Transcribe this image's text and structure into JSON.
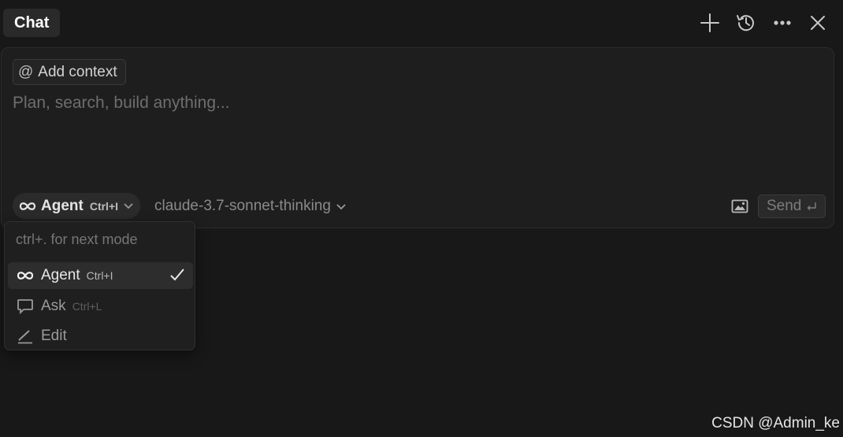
{
  "header": {
    "tab_label": "Chat",
    "icons": [
      "plus-icon",
      "history-icon",
      "more-icon",
      "close-icon"
    ]
  },
  "composer": {
    "add_context_label": "Add context",
    "add_context_symbol": "@",
    "placeholder": "Plan, search, build anything...",
    "value": "",
    "mode": {
      "label": "Agent",
      "shortcut": "Ctrl+I",
      "icon": "infinity-icon"
    },
    "model": "claude-3.7-sonnet-thinking",
    "send_label": "Send"
  },
  "mode_menu": {
    "hint": "ctrl+. for next mode",
    "items": [
      {
        "label": "Agent",
        "shortcut": "Ctrl+I",
        "icon": "infinity-icon",
        "selected": true
      },
      {
        "label": "Ask",
        "shortcut": "Ctrl+L",
        "icon": "chat-bubble-icon",
        "selected": false
      },
      {
        "label": "Edit",
        "shortcut": "",
        "icon": "pencil-icon",
        "selected": false
      }
    ]
  },
  "watermark": "CSDN @Admin_ke",
  "colors": {
    "background": "#181818",
    "panel": "#1e1e1e",
    "text": "#d6d6d6",
    "muted_text": "#6e6e6e"
  }
}
